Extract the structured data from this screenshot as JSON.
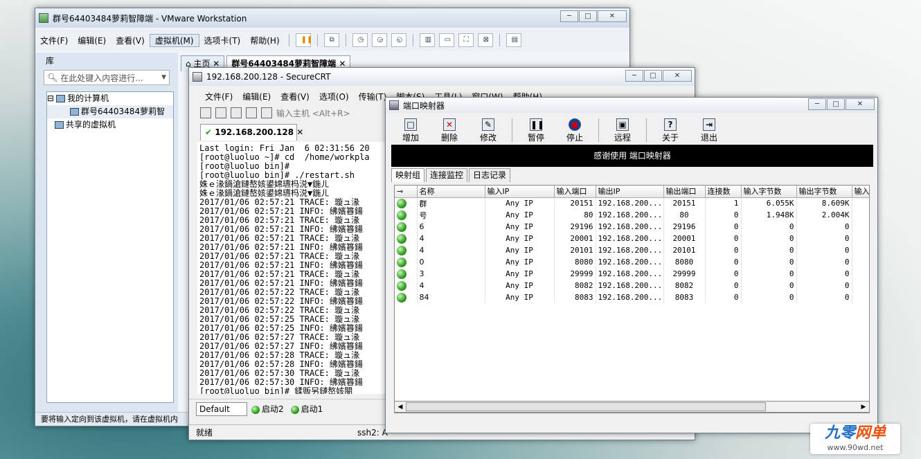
{
  "vmware": {
    "title": "群号64403484萝莉智障端 - VMware Workstation",
    "menu": [
      "文件(F)",
      "编辑(E)",
      "查看(V)",
      "虚拟机(M)",
      "选项卡(T)",
      "帮助(H)"
    ],
    "library_label": "库",
    "search_placeholder": "在此处键入内容进行...",
    "tree": {
      "root": "我的计算机",
      "vm": "群号64403484萝莉智",
      "shared": "共享的虚拟机"
    },
    "tabs": [
      "主页",
      "群号64403484萝莉智障端"
    ],
    "status": "要将输入定向到该虚拟机，请在虚拟机内"
  },
  "securecrt": {
    "title": "192.168.200.128 - SecureCRT",
    "menu": [
      "文件(F)",
      "编辑(E)",
      "查看(V)",
      "选项(O)",
      "传输(T)",
      "脚本(S)",
      "工具(L)",
      "窗口(W)",
      "帮助(H)"
    ],
    "host_placeholder": "输入主机 <Alt+R>",
    "session_tab": "192.168.200.128",
    "terminal_lines": [
      "Last login: Fri Jan  6 02:31:56 20",
      "[root@luoluo ~]# cd  /home/workpla",
      "[root@luoluo bin]#",
      "[root@luoluo bin]# ./restart.sh",
      "姝ｅ湪鍋滄鏈嶅姟鍙婂瓙杩涚▼鍦ㄦ",
      "姝ｅ湪鍋滄鏈嶅姟鍙婂瓙杩涚▼鍦ㄦ",
      "2017/01/06 02:57:21 TRACE: 璇ュ湪",
      "2017/01/06 02:57:21 INFO: 绋嬪簭鍚",
      "2017/01/06 02:57:21 TRACE: 璇ュ湪",
      "2017/01/06 02:57:21 INFO: 绋嬪簭鍚",
      "2017/01/06 02:57:21 TRACE: 璇ュ湪",
      "2017/01/06 02:57:21 INFO: 绋嬪簭鍚",
      "2017/01/06 02:57:21 TRACE: 璇ュ湪",
      "2017/01/06 02:57:21 INFO: 绋嬪簭鍚",
      "2017/01/06 02:57:21 TRACE: 璇ュ湪",
      "2017/01/06 02:57:21 INFO: 绋嬪簭鍚",
      "2017/01/06 02:57:22 TRACE: 璇ュ湪",
      "2017/01/06 02:57:22 INFO: 绋嬪簭鍚",
      "2017/01/06 02:57:22 TRACE: 璇ュ湪",
      "2017/01/06 02:57:25 TRACE: 璇ュ湪",
      "2017/01/06 02:57:25 INFO: 绋嬪簭鍚",
      "2017/01/06 02:57:27 TRACE: 璇ュ湪",
      "2017/01/06 02:57:27 INFO: 绋嬪簭鍚",
      "2017/01/06 02:57:28 TRACE: 璇ュ湪",
      "2017/01/06 02:57:28 INFO: 绋嬪簭鍚",
      "2017/01/06 02:57:30 TRACE: 璇ュ湪",
      "2017/01/06 02:57:30 INFO: 绋嬪簭鍚",
      "[root@luoluo bin]# 鍒贩另鏈嶅姟閿"
    ],
    "button_bar": {
      "select": "Default",
      "btn1": "启动2",
      "btn2": "启动1"
    },
    "status": {
      "ready": "就绪",
      "conn": "ssh2: A"
    }
  },
  "portmapper": {
    "title": "端口映射器",
    "toolbar": [
      {
        "label": "增加",
        "icon": "new-icon",
        "glyph": "□"
      },
      {
        "label": "删除",
        "icon": "delete-icon",
        "glyph": "✕"
      },
      {
        "label": "修改",
        "icon": "edit-icon",
        "glyph": "✎"
      },
      {
        "label": "暂停",
        "icon": "pause-icon",
        "glyph": "❚❚"
      },
      {
        "label": "停止",
        "icon": "stop-icon",
        "glyph": "●"
      },
      {
        "label": "远程",
        "icon": "remote-icon",
        "glyph": "▣"
      },
      {
        "label": "关于",
        "icon": "help-icon",
        "glyph": "?"
      },
      {
        "label": "退出",
        "icon": "exit-icon",
        "glyph": "⇥"
      }
    ],
    "banner": "感谢使用 端口映射器",
    "tabs": [
      "映射组",
      "连接监控",
      "日志记录"
    ],
    "columns": [
      "",
      "名称",
      "输入IP",
      "输入端口",
      "输出IP",
      "输出端口",
      "连接数",
      "输入字节数",
      "输出字节数",
      "输入"
    ],
    "rows": [
      [
        "群",
        "Any IP",
        "20151",
        "192.168.200...",
        "20151",
        "1",
        "6.055K",
        "8.609K"
      ],
      [
        "号",
        "Any IP",
        "80",
        "192.168.200...",
        "80",
        "0",
        "1.948K",
        "2.004K"
      ],
      [
        "6",
        "Any IP",
        "29196",
        "192.168.200...",
        "29196",
        "0",
        "0",
        "0"
      ],
      [
        "4",
        "Any IP",
        "20001",
        "192.168.200...",
        "20001",
        "0",
        "0",
        "0"
      ],
      [
        "4",
        "Any IP",
        "20101",
        "192.168.200...",
        "20101",
        "0",
        "0",
        "0"
      ],
      [
        "0",
        "Any IP",
        "8080",
        "192.168.200...",
        "8080",
        "0",
        "0",
        "0"
      ],
      [
        "3",
        "Any IP",
        "29999",
        "192.168.200...",
        "29999",
        "0",
        "0",
        "0"
      ],
      [
        "4",
        "Any IP",
        "8082",
        "192.168.200...",
        "8082",
        "0",
        "0",
        "0"
      ],
      [
        "84",
        "Any IP",
        "8083",
        "192.168.200...",
        "8083",
        "0",
        "0",
        "0"
      ]
    ]
  },
  "watermark": {
    "brand_a": "九零",
    "brand_b": "网单",
    "url": "www.90wd.net"
  }
}
